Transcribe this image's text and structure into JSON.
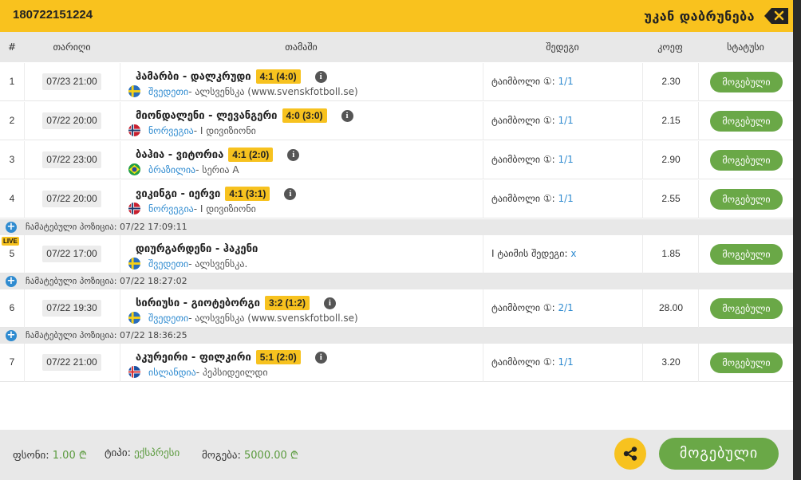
{
  "header": {
    "ticket_id": "180722151224",
    "back_label": "უკან დაბრუნება"
  },
  "columns": {
    "num": "#",
    "date": "თარიღი",
    "match": "თამაში",
    "outcome": "შედეგი",
    "odds": "კოეფ",
    "status": "სტატუსი"
  },
  "rows": [
    {
      "num": "1",
      "date": "07/23 21:00",
      "match": "ჰამარბი - დალკრუდი",
      "score": "4:1 (4:0)",
      "country": "შვედეთი",
      "league": " - ალსვენსკა (www.svenskfotboll.se)",
      "flag": "se",
      "outcome_label": "ტაიმბოლი ①: ",
      "outcome_value": "1/1",
      "odds": "2.30",
      "status": "მოგებული"
    },
    {
      "num": "2",
      "date": "07/22 20:00",
      "match": "მიონდალენი - ლევანგერი",
      "score": "4:0 (3:0)",
      "country": "ნორვეგია",
      "league": " - I დივიზიონი",
      "flag": "no",
      "outcome_label": "ტაიმბოლი ①: ",
      "outcome_value": "1/1",
      "odds": "2.15",
      "status": "მოგებული"
    },
    {
      "num": "3",
      "date": "07/22 23:00",
      "match": "ბაჰია - ვიტორია",
      "score": "4:1 (2:0)",
      "country": "ბრაზილია",
      "league": " - სერია A",
      "flag": "br",
      "outcome_label": "ტაიმბოლი ①: ",
      "outcome_value": "1/1",
      "odds": "2.90",
      "status": "მოგებული"
    },
    {
      "num": "4",
      "date": "07/22 20:00",
      "match": "ვიკინგი - იერვი",
      "score": "4:1 (3:1)",
      "country": "ნორვეგია",
      "league": " - I დივიზიონი",
      "flag": "no",
      "outcome_label": "ტაიმბოლი ①: ",
      "outcome_value": "1/1",
      "odds": "2.55",
      "status": "მოგებული"
    },
    {
      "num": "5",
      "date": "07/22 17:00",
      "match": "დიურგარდენი - ჰაკენი",
      "score": "",
      "country": "შვედეთი",
      "league": " - ალსვენსკა.",
      "flag": "se",
      "outcome_label": "I ტაიმის შედეგი: ",
      "outcome_value": "x",
      "odds": "1.85",
      "status": "მოგებული",
      "live": "LIVE"
    },
    {
      "num": "6",
      "date": "07/22 19:30",
      "match": "სირიუსი - გიოტებორგი",
      "score": "3:2 (1:2)",
      "country": "შვედეთი",
      "league": " - ალსვენსკა (www.svenskfotboll.se)",
      "flag": "se",
      "outcome_label": "ტაიმბოლი ①: ",
      "outcome_value": "2/1",
      "odds": "28.00",
      "status": "მოგებული"
    },
    {
      "num": "7",
      "date": "07/22 21:00",
      "match": "აკურეირი - ფილკირი",
      "score": "5:1 (2:0)",
      "country": "ისლანდია",
      "league": " - პეპსიდეილდი",
      "flag": "is",
      "outcome_label": "ტაიმბოლი ①: ",
      "outcome_value": "1/1",
      "odds": "3.20",
      "status": "მოგებული"
    }
  ],
  "notes": [
    "ჩამატებული პოზიცია: 07/22 17:09:11",
    "ჩამატებული პოზიცია: 07/22 18:27:02",
    "ჩამატებული პოზიცია: 07/22 18:36:25"
  ],
  "footer": {
    "stake_label": "ფსონი: ",
    "stake_value": "1.00 ₾",
    "type_label": "ტიპი: ",
    "type_value": "ექსპრესი",
    "win_label": "მოგება: ",
    "win_value": "5000.00 ₾",
    "result_button": "მოგებული"
  },
  "colors": {
    "accent": "#f9c21e",
    "win_green": "#6aa847",
    "link_blue": "#2f8bd0"
  },
  "icons": {
    "back": "backspace-icon",
    "info": "info-icon",
    "share": "share-icon",
    "add": "plus-icon"
  }
}
